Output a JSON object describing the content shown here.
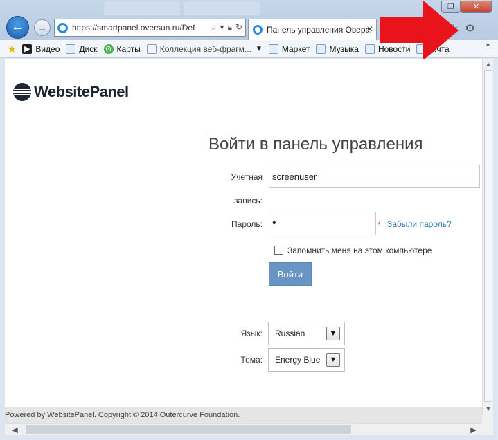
{
  "browser": {
    "address": "https://smartpanel.oversun.ru/Def",
    "address_host_bold": "oversun.ru",
    "tab_title": "Панель управления Оверс...",
    "tab_close": "✕",
    "back_glyph": "←",
    "forward_glyph": "→",
    "restore_glyph": "❐",
    "close_glyph": "✕",
    "toolbar_icons": [
      "home-icon",
      "star-icon",
      "gear-icon"
    ]
  },
  "favorites": {
    "items": [
      {
        "label": "Видео",
        "icon": "video-icon"
      },
      {
        "label": "Диск",
        "icon": "disk-icon"
      },
      {
        "label": "Карты",
        "icon": "maps-icon"
      },
      {
        "label": "Коллекция веб-фрагм...",
        "icon": "webslice-icon"
      },
      {
        "label": "Маркет",
        "icon": "market-icon"
      },
      {
        "label": "Музыка",
        "icon": "music-icon"
      },
      {
        "label": "Новости",
        "icon": "news-icon"
      },
      {
        "label": "...чта",
        "icon": "mail-icon"
      }
    ],
    "more": "»"
  },
  "page": {
    "logo_text": "WebsitePanel",
    "title": "Войти в панель управления",
    "username_label_1": "Учетная",
    "username_label_2": "запись:",
    "username_value": "screenuser",
    "password_label": "Пароль:",
    "password_value": "•",
    "required_mark": "*",
    "forgot_link": "Забыли пароль?",
    "remember_label": "Запомнить меня на этом компьютере",
    "remember_checked": false,
    "login_button": "Войти",
    "language_label": "Язык:",
    "language_value": "Russian",
    "theme_label": "Тема:",
    "theme_value": "Energy Blue",
    "footer": "Powered by WebsitePanel. Copyright © 2014 Outercurve Foundation."
  },
  "colors": {
    "accent_button": "#6796c4",
    "link": "#2a7ab0",
    "annotation_arrow": "#e8131b"
  }
}
